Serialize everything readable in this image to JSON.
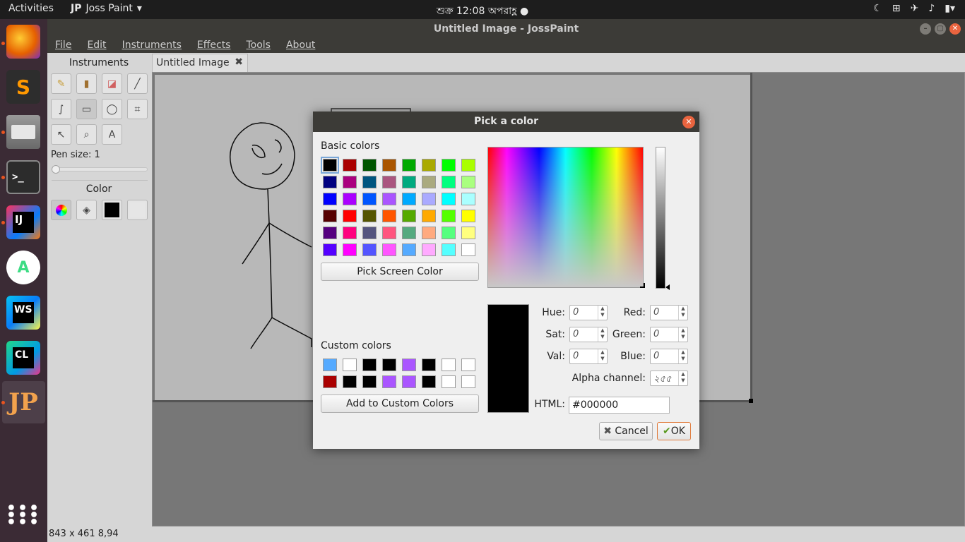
{
  "topbar": {
    "activities": "Activities",
    "app_name": "Joss Paint",
    "app_badge": "JP",
    "clock": "শুক্র 12:08 অপরাহ্ণ"
  },
  "dock": [
    {
      "name": "firefox",
      "color": "#e66000"
    },
    {
      "name": "sublime-text",
      "color": "#ff9800"
    },
    {
      "name": "files",
      "color": "#8f8f8f"
    },
    {
      "name": "terminal",
      "color": "#2c2c2c"
    },
    {
      "name": "intellij",
      "color": "#fe315d"
    },
    {
      "name": "android-studio",
      "color": "#3ddc84"
    },
    {
      "name": "webstorm",
      "color": "#07c3f2"
    },
    {
      "name": "clion",
      "color": "#21d789"
    },
    {
      "name": "joss-paint",
      "color": "#e95420"
    }
  ],
  "window": {
    "title": "Untitled Image - JossPaint",
    "menu": [
      "File",
      "Edit",
      "Instruments",
      "Effects",
      "Tools",
      "About"
    ],
    "tab_label": "Untitled Image",
    "tab_close": "✖",
    "status": "843 x 461  8,94"
  },
  "instruments": {
    "title": "Instruments",
    "pen_size_label": "Pen size: 1",
    "pen_size": 1,
    "color_title": "Color",
    "text_tool": "A"
  },
  "dialog": {
    "title": "Pick a color",
    "basic_colors_label": "Basic colors",
    "basic_colors": [
      [
        "#000000",
        "#aa0000",
        "#005500",
        "#aa5500",
        "#00aa00",
        "#aaaa00",
        "#00ff00",
        "#aaff00"
      ],
      [
        "#00007f",
        "#aa007f",
        "#00557f",
        "#aa557f",
        "#00aa7f",
        "#aaaa7f",
        "#00ff7f",
        "#aaff7f"
      ],
      [
        "#0000ff",
        "#aa00ff",
        "#0055ff",
        "#aa55ff",
        "#00aaff",
        "#aaaaff",
        "#00ffff",
        "#aaffff"
      ],
      [
        "#550000",
        "#ff0000",
        "#555500",
        "#ff5500",
        "#55aa00",
        "#ffaa00",
        "#55ff00",
        "#ffff00"
      ],
      [
        "#55007f",
        "#ff007f",
        "#55557f",
        "#ff557f",
        "#55aa7f",
        "#ffaa7f",
        "#55ff7f",
        "#ffff7f"
      ],
      [
        "#5500ff",
        "#ff00ff",
        "#5555ff",
        "#ff55ff",
        "#55aaff",
        "#ffaaff",
        "#55ffff",
        "#ffffff"
      ]
    ],
    "pick_screen_color": "Pick Screen Color",
    "custom_colors_label": "Custom colors",
    "custom_colors": [
      [
        "#55aaff",
        "#ffffff",
        "#000000",
        "#000000",
        "#aa55ff",
        "#000000",
        "#ffffff",
        "#ffffff"
      ],
      [
        "#aa0000",
        "#000000",
        "#000000",
        "#aa55ff",
        "#aa55ff",
        "#000000",
        "#ffffff",
        "#ffffff"
      ]
    ],
    "add_custom": "Add to Custom Colors",
    "hue_label": "Hue:",
    "hue": "0",
    "sat_label": "Sat:",
    "sat": "0",
    "val_label": "Val:",
    "val": "0",
    "red_label": "Red:",
    "red": "0",
    "green_label": "Green:",
    "green": "0",
    "blue_label": "Blue:",
    "blue": "0",
    "alpha_label": "Alpha channel:",
    "alpha": "২৫৫",
    "html_label": "HTML:",
    "html_value": "#000000",
    "cancel": "Cancel",
    "ok": "OK",
    "current_color": "#000000"
  }
}
